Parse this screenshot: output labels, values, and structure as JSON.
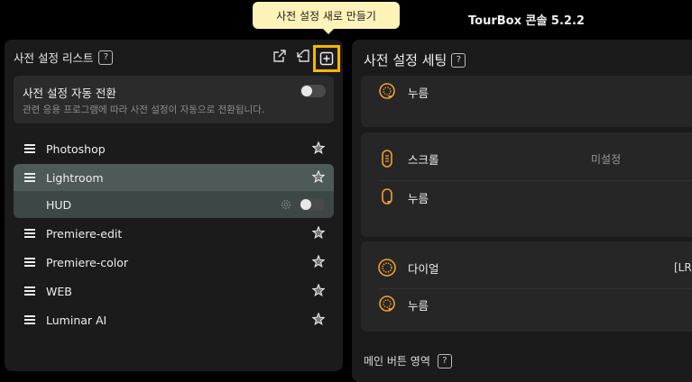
{
  "app": {
    "title": "TourBox 콘솔 5.2.2"
  },
  "tooltip": {
    "text": "사전 설정 새로 만들기"
  },
  "left_panel": {
    "title": "사전 설정 리스트",
    "help": "?",
    "auto_switch": {
      "title": "사전 설정 자동 전환",
      "description": "관련 응용 프로그램에 따라 사전 설정이 자동으로 전환됩니다."
    },
    "presets": [
      {
        "label": "Photoshop"
      },
      {
        "label": "Lightroom"
      },
      {
        "label": "HUD"
      },
      {
        "label": "Premiere-edit"
      },
      {
        "label": "Premiere-color"
      },
      {
        "label": "WEB"
      },
      {
        "label": "Luminar AI"
      }
    ]
  },
  "right_panel": {
    "title": "사전 설정 세팅",
    "help": "?",
    "card1": {
      "press_label": "누름"
    },
    "card2": {
      "scroll_label": "스크롤",
      "scroll_value": "미설정",
      "press_label": "누름"
    },
    "card3": {
      "dial_label": "다이얼",
      "dial_value": "[LR]",
      "press_label": "누름"
    },
    "main_button_area": "메인 버튼 영역"
  },
  "colors": {
    "accent": "#f5b800",
    "icon_orange": "#f0a030",
    "selected_row": "#4d5a58"
  }
}
